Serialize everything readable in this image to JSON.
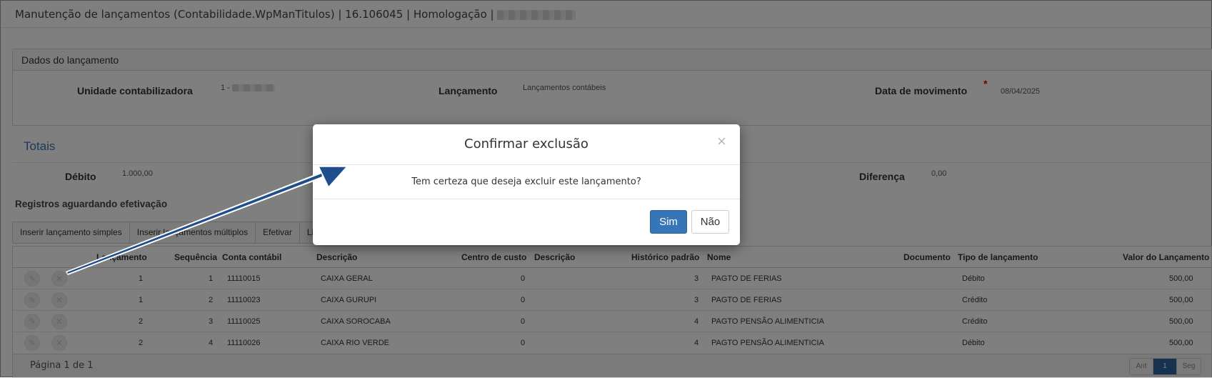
{
  "title": {
    "text": "Manutenção de lançamentos (Contabilidade.WpManTitulos) | 16.106045 | Homologação |"
  },
  "dados": {
    "heading": "Dados do lançamento",
    "unidade_label": "Unidade contabilizadora",
    "unidade_value": "1 -",
    "lancamento_label": "Lançamento",
    "lancamento_value": "Lançamentos contábeis",
    "data_label": "Data de movimento",
    "required_mark": "*",
    "data_value": "08/04/2025"
  },
  "totais": {
    "heading": "Totais",
    "debito_label": "Débito",
    "debito_value": "1.000,00",
    "diferenca_label": "Diferença",
    "diferenca_value": "0,00"
  },
  "registros": {
    "heading": "Registros aguardando efetivação"
  },
  "toolbar": {
    "buttons": [
      "Inserir lançamento simples",
      "Inserir lançamentos múltiplos",
      "Efetivar",
      "Li"
    ]
  },
  "grid": {
    "headers": [
      "Lançamento",
      "Sequência",
      "Conta contábil",
      "Descrição",
      "Centro de custo",
      "Descrição",
      "Histórico padrão",
      "Nome",
      "Documento",
      "Tipo de lançamento",
      "Valor do Lançamento"
    ],
    "rows": [
      {
        "lancamento": "1",
        "sequencia": "1",
        "conta": "11110015",
        "descricao": "CAIXA GERAL",
        "centro": "0",
        "historico": "3",
        "nome": "PAGTO DE FERIAS",
        "tipo": "Débito",
        "valor": "500,00"
      },
      {
        "lancamento": "1",
        "sequencia": "2",
        "conta": "11110023",
        "descricao": "CAIXA GURUPI",
        "centro": "0",
        "historico": "3",
        "nome": "PAGTO DE FERIAS",
        "tipo": "Crédito",
        "valor": "500,00"
      },
      {
        "lancamento": "2",
        "sequencia": "3",
        "conta": "11110025",
        "descricao": "CAIXA SOROCABA",
        "centro": "0",
        "historico": "4",
        "nome": "PAGTO PENSÃO ALIMENTICIA",
        "tipo": "Crédito",
        "valor": "500,00"
      },
      {
        "lancamento": "2",
        "sequencia": "4",
        "conta": "11110026",
        "descricao": "CAIXA RIO VERDE",
        "centro": "0",
        "historico": "4",
        "nome": "PAGTO PENSÃO ALIMENTICIA",
        "tipo": "Débito",
        "valor": "500,00"
      }
    ],
    "edit_icon_glyph": "✎",
    "delete_icon_glyph": "✕"
  },
  "pagination": {
    "text": "Página 1 de 1",
    "prev": "Ant",
    "current": "1",
    "next": "Seg"
  },
  "modal": {
    "title": "Confirmar exclusão",
    "close": "×",
    "message": "Tem certeza que deseja excluir este lançamento?",
    "confirm": "Sim",
    "cancel": "Não"
  },
  "colors": {
    "accent": "#3675b8",
    "totais_heading": "#3b73b0",
    "required": "#dd0000",
    "pager_active": "#2f62a0",
    "arrow": "#1f4e8c"
  }
}
